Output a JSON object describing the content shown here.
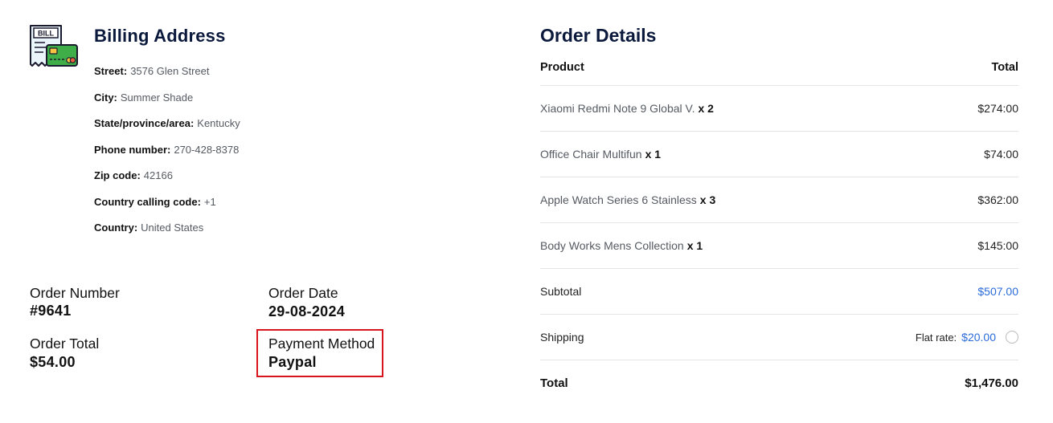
{
  "billing": {
    "title": "Billing Address",
    "icon": "bill-with-credit-card-icon",
    "bill_text": "BILL",
    "rows": [
      {
        "key": "Street:",
        "value": "3576 Glen Street"
      },
      {
        "key": "City:",
        "value": "Summer Shade"
      },
      {
        "key": "State/province/area:",
        "value": "Kentucky"
      },
      {
        "key": "Phone number:",
        "value": "270-428-8378"
      },
      {
        "key": "Zip code:",
        "value": "42166"
      },
      {
        "key": "Country calling code:",
        "value": "+1"
      },
      {
        "key": "Country:",
        "value": "United States"
      }
    ]
  },
  "summary": {
    "order_number_label": "Order Number",
    "order_number": "#9641",
    "order_date_label": "Order Date",
    "order_date": "29-08-2024",
    "order_total_label": "Order Total",
    "order_total": "$54.00",
    "payment_method_label": "Payment Method",
    "payment_method": "Paypal",
    "highlight_color": "#d9141c"
  },
  "order_details": {
    "title": "Order Details",
    "col_product": "Product",
    "col_total": "Total",
    "items": [
      {
        "name": "Xiaomi Redmi Note 9 Global V.",
        "qty": "x 2",
        "price": "$274:00"
      },
      {
        "name": "Office Chair Multifun",
        "qty": "x 1",
        "price": "$74:00"
      },
      {
        "name": "Apple Watch Series 6 Stainless",
        "qty": "x 3",
        "price": "$362:00"
      },
      {
        "name": "Body Works Mens Collection",
        "qty": "x 1",
        "price": "$145:00"
      }
    ],
    "subtotal_label": "Subtotal",
    "subtotal": "$507.00",
    "shipping_label": "Shipping",
    "shipping_method": "Flat rate:",
    "shipping_cost": "$20.00",
    "total_label": "Total",
    "total": "$1,476.00",
    "accent_color": "#2b6cd9"
  }
}
